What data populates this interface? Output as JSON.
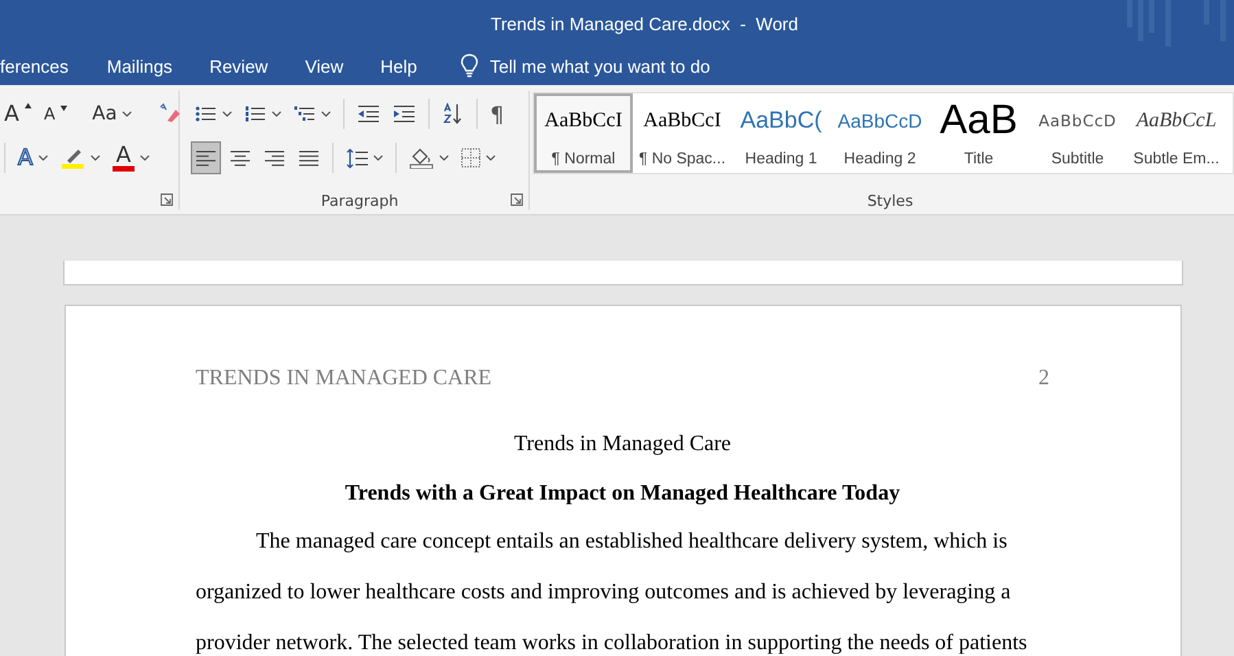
{
  "window": {
    "title": "Trends in Managed Care.docx  -  Word"
  },
  "tabs": [
    {
      "label": "ferences",
      "selected": false
    },
    {
      "label": "Mailings",
      "selected": false
    },
    {
      "label": "Review",
      "selected": false
    },
    {
      "label": "View",
      "selected": false
    },
    {
      "label": "Help",
      "selected": false
    }
  ],
  "tell_me": {
    "placeholder": "Tell me what you want to do"
  },
  "font_group": {
    "row_1": [
      {
        "kind": "grow",
        "glyph": "A"
      },
      {
        "kind": "shrink",
        "glyph": "A"
      },
      {
        "kind": "case",
        "glyph": "Aa"
      },
      {
        "kind": "clear"
      }
    ],
    "row_2": [
      {
        "kind": "effects",
        "glyph": "A"
      },
      {
        "kind": "highlight"
      },
      {
        "kind": "color",
        "glyph": "A"
      }
    ]
  },
  "paragraph_group": {
    "label": "Paragraph",
    "row_1": [
      {
        "kind": "bullets"
      },
      {
        "kind": "numbering"
      },
      {
        "kind": "multilevel"
      },
      {
        "kind": "outdent"
      },
      {
        "kind": "indent"
      },
      {
        "kind": "sort"
      },
      {
        "kind": "pilcrow",
        "glyph": "¶"
      }
    ],
    "alignment": [
      {
        "kind": "left",
        "selected": true
      },
      {
        "kind": "center",
        "selected": false
      },
      {
        "kind": "right",
        "selected": false
      },
      {
        "kind": "justify",
        "selected": false
      }
    ],
    "row_2": [
      {
        "kind": "spacing"
      },
      {
        "kind": "shading"
      },
      {
        "kind": "borders"
      }
    ]
  },
  "styles_group": {
    "label": "Styles",
    "styles": [
      {
        "preview": "AaBbCcI",
        "label": "¶ Normal",
        "kind": "normal",
        "selected": true
      },
      {
        "preview": "AaBbCcI",
        "label": "¶ No Spac...",
        "kind": "nospacing",
        "selected": false
      },
      {
        "preview": "AaBbC(",
        "label": "Heading 1",
        "kind": "heading1",
        "selected": false
      },
      {
        "preview": "AaBbCcD",
        "label": "Heading 2",
        "kind": "heading2",
        "selected": false
      },
      {
        "preview": "AaB",
        "label": "Title",
        "kind": "title",
        "selected": false
      },
      {
        "preview": "AaBbCcD",
        "label": "Subtitle",
        "kind": "subtitle",
        "selected": false
      },
      {
        "preview": "AaBbCcL",
        "label": "Subtle Em...",
        "kind": "emphasis",
        "selected": false
      }
    ]
  },
  "document": {
    "header": "TRENDS IN MANAGED CARE",
    "page_number": "2",
    "title": "Trends in Managed Care",
    "heading": "Trends with a Great Impact on Managed Healthcare Today",
    "paragraph": "The managed care concept entails an established healthcare delivery system, which is organized to lower healthcare costs and improving outcomes and is achieved by leveraging a provider network. The selected team works in collaboration in supporting the needs of patients"
  }
}
